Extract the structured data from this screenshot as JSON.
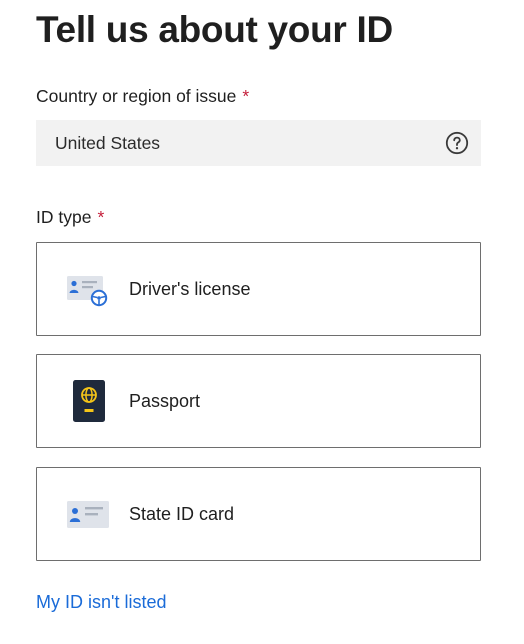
{
  "page": {
    "title": "Tell us about your ID"
  },
  "country_field": {
    "label": "Country or region of issue",
    "required_marker": "*",
    "value": "United States",
    "help_icon": "question-circle-icon"
  },
  "id_type": {
    "label": "ID type",
    "required_marker": "*",
    "options": [
      {
        "label": "Driver's license",
        "icon": "drivers-license-icon"
      },
      {
        "label": "Passport",
        "icon": "passport-icon"
      },
      {
        "label": "State ID card",
        "icon": "state-id-card-icon"
      }
    ]
  },
  "footer": {
    "not_listed_link": "My ID isn't listed"
  },
  "colors": {
    "text": "#1f1f1f",
    "required": "#c41e3a",
    "link": "#1a6bd8",
    "field_background": "#f2f2f2",
    "border": "#6e6e6e",
    "icon_blue": "#2b6fd6",
    "passport_dark": "#1f2a3c",
    "passport_gold": "#f5c518"
  }
}
